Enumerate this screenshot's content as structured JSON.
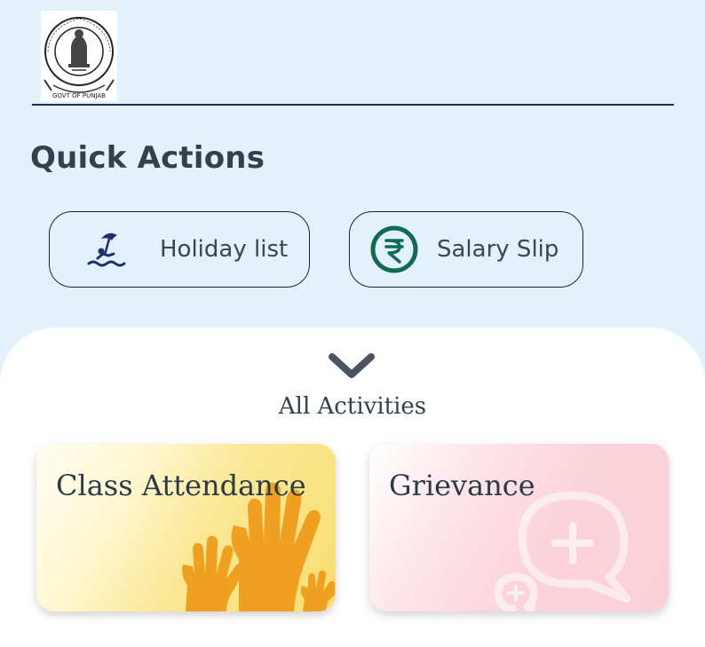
{
  "header": {
    "emblem_text_top": "GOVT OF PUNJAB",
    "emblem_text_bottom": "GOVT OF PUNJAB"
  },
  "quick_actions": {
    "title": "Quick Actions",
    "items": [
      {
        "label": "Holiday list",
        "icon": "beach-umbrella-icon"
      },
      {
        "label": "Salary Slip",
        "icon": "rupee-icon"
      }
    ]
  },
  "activities": {
    "title": "All Activities",
    "cards": [
      {
        "label": "Class Attendance",
        "icon": "raised-hands-icon",
        "color": "#f7dd70"
      },
      {
        "label": "Grievance",
        "icon": "chat-plus-icon",
        "color": "#fad0d7"
      }
    ]
  },
  "colors": {
    "background": "#e3f1fc",
    "heading": "#33414d",
    "rupee_green": "#0f6b52",
    "umbrella_blue": "#1f2e6e",
    "hands_orange": "#f0a020"
  }
}
